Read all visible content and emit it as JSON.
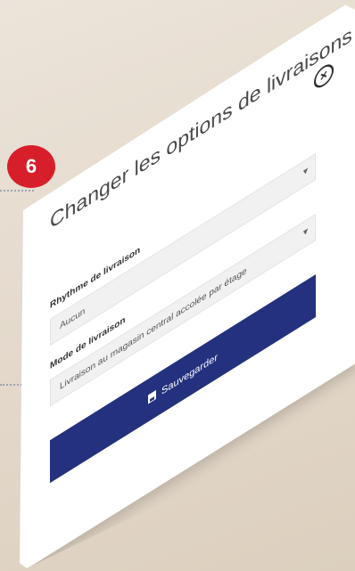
{
  "step_badge": "6",
  "dialog": {
    "close_symbol": "×",
    "title": "Changer les options de livraisons",
    "field1": {
      "label": "Rhythme de livraison",
      "value": "Aucun"
    },
    "field2": {
      "label": "Mode de livraison",
      "value": "Livraison au magasin central accolée par étage"
    },
    "save_label": "Sauvegarder"
  },
  "colors": {
    "primary": "#23317f",
    "badge": "#d71f2c",
    "background": "#e6ddd1"
  },
  "icons": {
    "close": "close-circle-icon",
    "save": "floppy-disk-icon",
    "dropdown": "chevron-down-icon"
  }
}
